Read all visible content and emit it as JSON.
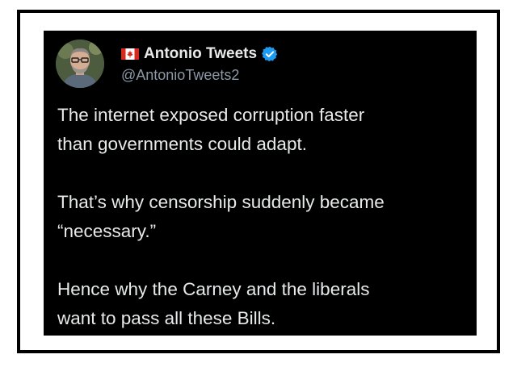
{
  "author": {
    "display_name": "Antonio Tweets",
    "handle": "@AntonioTweets2",
    "flag_icon": "canada-flag-icon",
    "verified_icon": "verified-badge-icon",
    "verified_color": "#1d9bf0"
  },
  "tweet": {
    "paragraphs": [
      "The internet exposed corruption faster\nthan governments could adapt.",
      "That’s why censorship suddenly became\n“necessary.”",
      "Hence why the Carney and the liberals\nwant to pass all these Bills."
    ]
  },
  "colors": {
    "card_background": "#000000",
    "text_primary": "#e7e9ea",
    "text_secondary": "#8b98a5",
    "frame_border": "#000000"
  }
}
